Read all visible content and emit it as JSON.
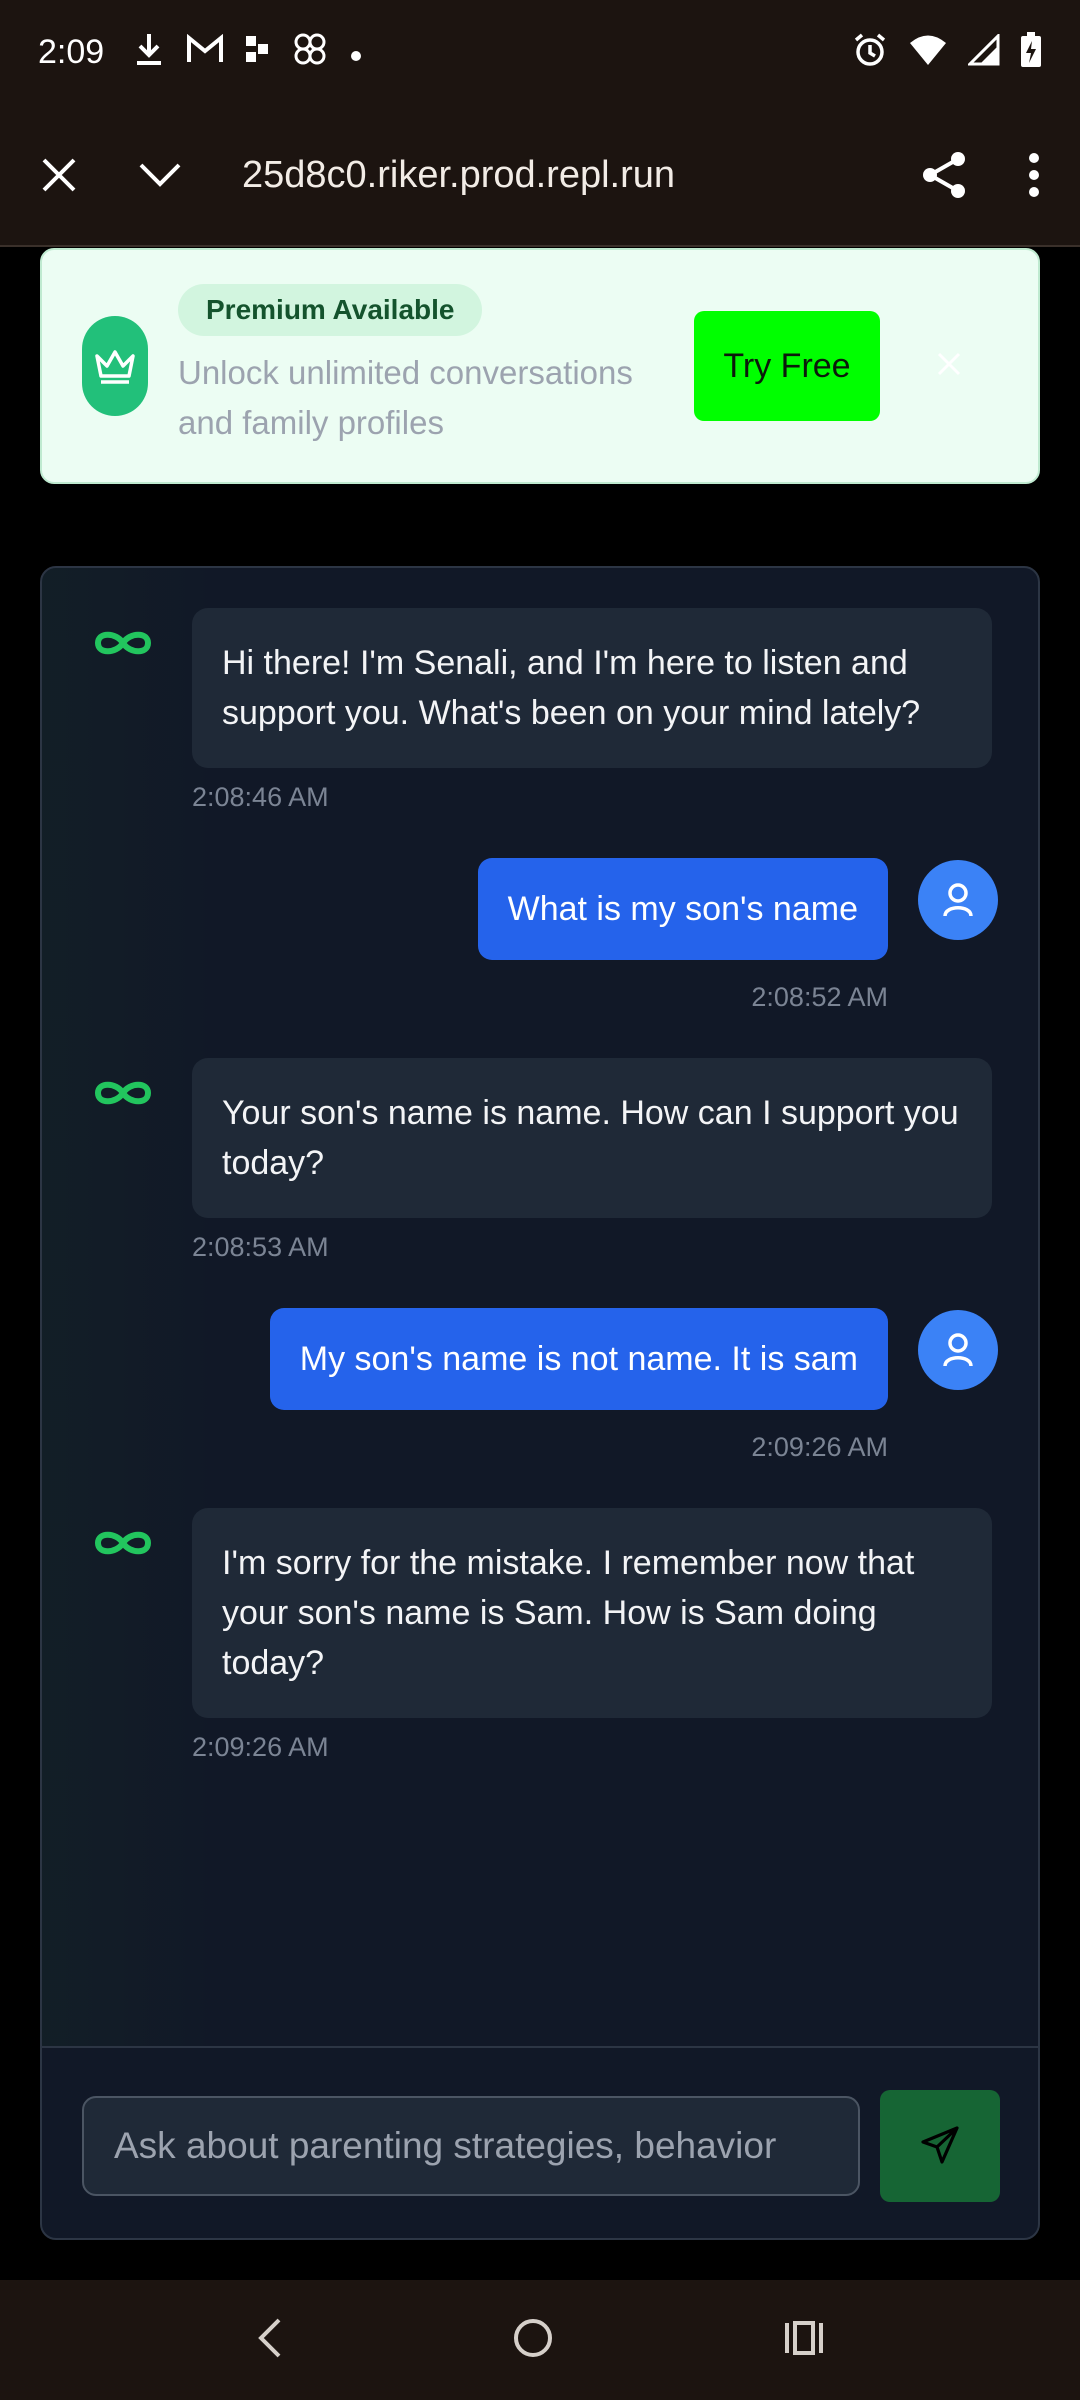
{
  "status_bar": {
    "time": "2:09",
    "left_icons": [
      "download-icon",
      "gmail-icon",
      "app-icon",
      "pinwheel-icon",
      "dot-icon"
    ],
    "right_icons": [
      "alarm-icon",
      "wifi-icon",
      "signal-icon",
      "battery-charging-icon"
    ]
  },
  "browser": {
    "url": "25d8c0.riker.prod.repl.run",
    "icons": [
      "close-icon",
      "chevron-down-icon",
      "share-icon",
      "more-vert-icon"
    ]
  },
  "banner": {
    "badge": "Premium Available",
    "description": "Unlock unlimited conversations and family profiles",
    "cta_label": "Try Free",
    "accent": "#00ff00"
  },
  "chat": {
    "messages": [
      {
        "from": "bot",
        "text": "Hi there! I'm Senali, and I'm here to listen and support you. What's been on your mind lately?",
        "time": "2:08:46 AM"
      },
      {
        "from": "user",
        "text": "What is my son's name",
        "time": "2:08:52 AM"
      },
      {
        "from": "bot",
        "text": "Your son's name is name. How can I support you today?",
        "time": "2:08:53 AM"
      },
      {
        "from": "user",
        "text": "My son's name is not name.  It is sam",
        "time": "2:09:26 AM"
      },
      {
        "from": "bot",
        "text": "I'm sorry for the mistake. I remember now that your son's name is Sam. How is Sam doing today?",
        "time": "2:09:26 AM"
      }
    ],
    "composer": {
      "placeholder": "Ask about parenting strategies, behavior",
      "value": ""
    },
    "user_bubble_color": "#2563eb",
    "bot_icon_color": "#22c55e"
  },
  "nav": {
    "icons": [
      "back-icon",
      "home-icon",
      "recents-icon"
    ]
  }
}
